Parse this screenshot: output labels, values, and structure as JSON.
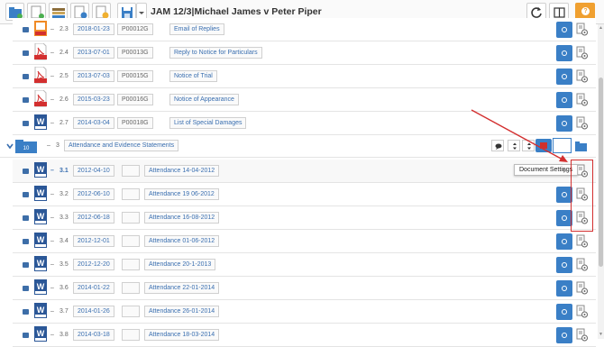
{
  "toolbar": {
    "title": "JAM 12/3|Michael James v Peter Piper",
    "icons": [
      "new-folder-icon",
      "add-document-icon",
      "stack-icon",
      "document-settings-icon",
      "folder-clock-icon",
      "save-icon",
      "chevron-down-icon",
      "refresh-icon",
      "layout-icon",
      "help-icon"
    ]
  },
  "section": {
    "number": "3",
    "title": "Attendance and Evidence Statements"
  },
  "tooltip": {
    "text": "Document Settings"
  },
  "accent_color": "#3a7fc6",
  "highlight_color": "#d32f2f",
  "rows": [
    {
      "num": "2.3",
      "type": "pdf",
      "date": "2018-01-23",
      "code": "P00012G",
      "title": "Email of Replies"
    },
    {
      "num": "2.4",
      "type": "pdf",
      "date": "2013-07-01",
      "code": "P00013G",
      "title": "Reply to Notice for Particulars"
    },
    {
      "num": "2.5",
      "type": "pdf",
      "date": "2013-07-03",
      "code": "P00015G",
      "title": "Notice of Trial"
    },
    {
      "num": "2.6",
      "type": "pdf",
      "date": "2015-03-23",
      "code": "P00016G",
      "title": "Notice of Appearance"
    },
    {
      "num": "2.7",
      "type": "word",
      "date": "2014-03-04",
      "code": "P00018G",
      "title": "List of Special Damages"
    },
    {
      "num": "3.1",
      "type": "word",
      "date": "2012-04-10",
      "code": "",
      "title": "Attendance 14-04-2012"
    },
    {
      "num": "3.2",
      "type": "word",
      "date": "2012-06-10",
      "code": "",
      "title": "Attendance 19 06-2012"
    },
    {
      "num": "3.3",
      "type": "word",
      "date": "2012-06-18",
      "code": "",
      "title": "Attendance 16-08-2012"
    },
    {
      "num": "3.4",
      "type": "word",
      "date": "2012-12-01",
      "code": "",
      "title": "Attendance 01-06-2012"
    },
    {
      "num": "3.5",
      "type": "word",
      "date": "2012-12-20",
      "code": "",
      "title": "Attendance 20-1-2013"
    },
    {
      "num": "3.6",
      "type": "word",
      "date": "2014-01-22",
      "code": "",
      "title": "Attendance 22-01-2014"
    },
    {
      "num": "3.7",
      "type": "word",
      "date": "2014-01-26",
      "code": "",
      "title": "Attendance 26-01-2014"
    },
    {
      "num": "3.8",
      "type": "word",
      "date": "2014-03-18",
      "code": "",
      "title": "Attendance 18-03-2014"
    }
  ]
}
